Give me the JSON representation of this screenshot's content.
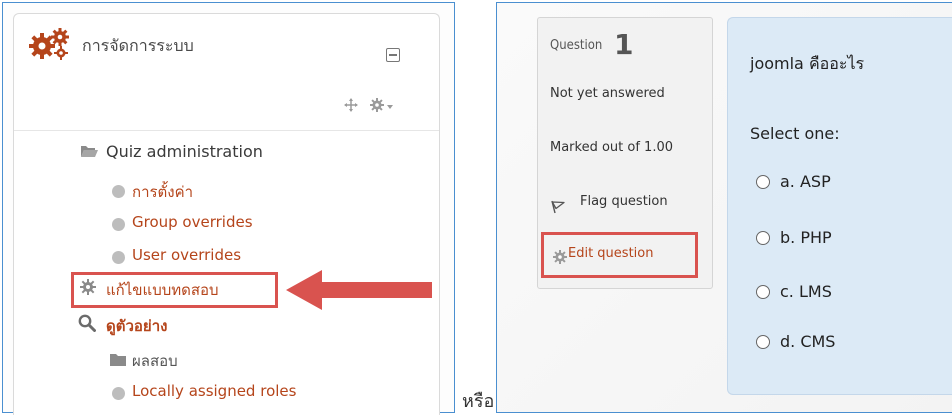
{
  "left_panel": {
    "block_title": "การจัดการระบบ",
    "items": [
      {
        "label": "Quiz administration"
      },
      {
        "label": "การตั้งค่า"
      },
      {
        "label": "Group overrides"
      },
      {
        "label": "User overrides"
      },
      {
        "label": "แก้ไขแบบทดสอบ"
      },
      {
        "label": "ดูตัวอย่าง"
      },
      {
        "label": "ผลสอบ"
      },
      {
        "label": "Locally assigned roles"
      }
    ]
  },
  "separator_text": "หรือ",
  "right_panel": {
    "question_label": "Question",
    "question_number": "1",
    "status": "Not yet answered",
    "marks": "Marked out of 1.00",
    "flag_label": "Flag question",
    "edit_label": "Edit question",
    "question_text": "joomla คืออะไร",
    "select_prompt": "Select one:",
    "options": [
      {
        "label": "a. ASP"
      },
      {
        "label": "b. PHP"
      },
      {
        "label": "c. LMS"
      },
      {
        "label": "d. CMS"
      }
    ]
  },
  "colors": {
    "frame_border": "#4a8fd0",
    "highlight_red": "#d9534f",
    "link_red": "#b5451b",
    "answer_bg": "#dceaf6"
  }
}
